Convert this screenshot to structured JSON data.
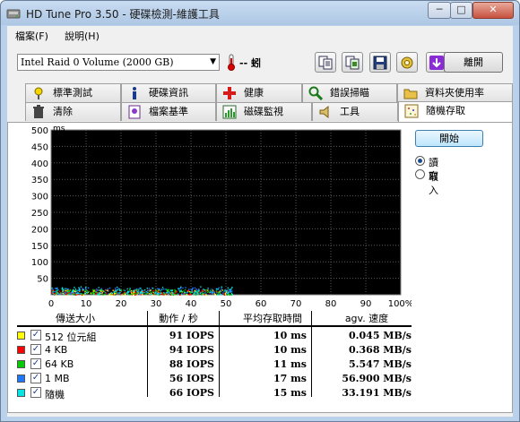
{
  "window": {
    "title": "HD Tune Pro 3.50 - 硬碟檢測-維護工具",
    "minimize": "─",
    "maximize": "□",
    "close": "✕"
  },
  "menu": [
    {
      "label": "檔案(F)"
    },
    {
      "label": "說明(H)"
    }
  ],
  "toolbar": {
    "drive": "Intel  Raid 0 Volume (2000 GB)",
    "temperature": "-- 蚓",
    "buttons": [
      "copy-text-icon",
      "copy-screen-icon",
      "save-icon",
      "options-icon",
      "download-icon"
    ],
    "exit_label": "離開"
  },
  "tabs_row1": [
    {
      "label": "標準測試",
      "icon": "benchmark-icon"
    },
    {
      "label": "硬碟資訊",
      "icon": "info-icon"
    },
    {
      "label": "健康",
      "icon": "health-icon"
    },
    {
      "label": "錯誤掃瞄",
      "icon": "error-scan-icon"
    },
    {
      "label": "資料夾使用率",
      "icon": "folder-usage-icon"
    }
  ],
  "tabs_row2": [
    {
      "label": "清除",
      "icon": "erase-icon"
    },
    {
      "label": "檔案基準",
      "icon": "file-benchmark-icon"
    },
    {
      "label": "磁碟監視",
      "icon": "disk-monitor-icon"
    },
    {
      "label": "工具",
      "icon": "tools-icon"
    },
    {
      "label": "隨機存取",
      "icon": "random-access-icon",
      "active": true
    }
  ],
  "controls": {
    "start_label": "開始",
    "mode_options": [
      {
        "label": "讀取",
        "selected": true
      },
      {
        "label": "寫入",
        "selected": false
      }
    ]
  },
  "chart_data": {
    "type": "scatter",
    "title": "",
    "xlabel": "",
    "ylabel": "ms",
    "xlim": [
      0,
      100
    ],
    "ylim": [
      0,
      500
    ],
    "x_ticks": [
      "0",
      "10",
      "20",
      "30",
      "40",
      "50",
      "60",
      "70",
      "80",
      "90",
      "100%"
    ],
    "y_ticks": [
      "500",
      "450",
      "400",
      "350",
      "300",
      "250",
      "200",
      "150",
      "100",
      "50"
    ],
    "grid": true,
    "background": "#000000",
    "series": [
      {
        "name": "512 位元組",
        "color": "#ffff00",
        "x_range": [
          0,
          52
        ],
        "y_range": [
          1,
          16
        ]
      },
      {
        "name": "4 KB",
        "color": "#ff0000",
        "x_range": [
          0,
          52
        ],
        "y_range": [
          1,
          16
        ]
      },
      {
        "name": "64 KB",
        "color": "#00cc00",
        "x_range": [
          0,
          52
        ],
        "y_range": [
          1,
          18
        ]
      },
      {
        "name": "1 MB",
        "color": "#1e78ff",
        "x_range": [
          0,
          52
        ],
        "y_range": [
          4,
          24
        ]
      },
      {
        "name": "隨機",
        "color": "#00e5e5",
        "x_range": [
          0,
          52
        ],
        "y_range": [
          2,
          26
        ]
      }
    ]
  },
  "results": {
    "headers": [
      "傳送大小",
      "動作 / 秒",
      "平均存取時間",
      "agv. 速度"
    ],
    "rows": [
      {
        "label": "512 位元組",
        "color": "#ffff00",
        "checked": "✓",
        "iops": "91 IOPS",
        "access": "10 ms",
        "speed": "0.045 MB/s"
      },
      {
        "label": "4 KB",
        "color": "#ff0000",
        "checked": "✓",
        "iops": "94 IOPS",
        "access": "10 ms",
        "speed": "0.368 MB/s"
      },
      {
        "label": "64 KB",
        "color": "#00cc00",
        "checked": "✓",
        "iops": "88 IOPS",
        "access": "11 ms",
        "speed": "5.547 MB/s"
      },
      {
        "label": "1 MB",
        "color": "#1e78ff",
        "checked": "✓",
        "iops": "56 IOPS",
        "access": "17 ms",
        "speed": "56.900 MB/s"
      },
      {
        "label": "隨機",
        "color": "#00e5e5",
        "checked": "✓",
        "iops": "66 IOPS",
        "access": "15 ms",
        "speed": "33.191 MB/s"
      }
    ]
  }
}
